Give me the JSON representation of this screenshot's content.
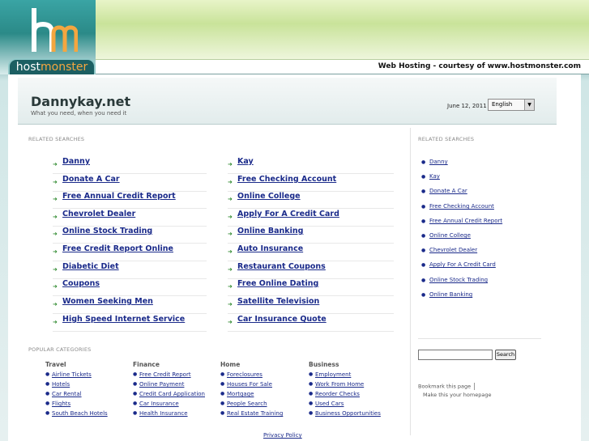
{
  "branding": {
    "logo_word_host": "host",
    "logo_word_monster": "monster",
    "hosting_line": "Web Hosting - courtesy of www.hostmonster.com"
  },
  "header": {
    "site_title": "Dannykay.net",
    "tagline": "What you need, when you need it",
    "date": "June 12, 2011",
    "language": "English"
  },
  "related_searches": {
    "label": "RELATED SEARCHES",
    "left": [
      "Danny",
      "Donate A Car",
      "Free Annual Credit Report",
      "Chevrolet Dealer",
      "Online Stock Trading",
      "Free Credit Report Online",
      "Diabetic Diet",
      "Coupons",
      "Women Seeking Men",
      "High Speed Internet Service"
    ],
    "right": [
      "Kay",
      "Free Checking Account",
      "Online College",
      "Apply For A Credit Card",
      "Online Banking",
      "Auto Insurance",
      "Restaurant Coupons",
      "Free Online Dating",
      "Satellite Television",
      "Car Insurance Quote"
    ]
  },
  "sidebar": {
    "label": "RELATED SEARCHES",
    "items": [
      "Danny",
      "Kay",
      "Donate A Car",
      "Free Checking Account",
      "Free Annual Credit Report",
      "Online College",
      "Chevrolet Dealer",
      "Apply For A Credit Card",
      "Online Stock Trading",
      "Online Banking"
    ],
    "search_button": "Search",
    "bookmark": "Bookmark this page",
    "homepage": "Make this your homepage"
  },
  "popular": {
    "label": "POPULAR CATEGORIES",
    "columns": [
      {
        "title": "Travel",
        "links": [
          "Airline Tickets",
          "Hotels",
          "Car Rental",
          "Flights",
          "South Beach Hotels"
        ]
      },
      {
        "title": "Finance",
        "links": [
          "Free Credit Report",
          "Online Payment",
          "Credit Card Application",
          "Car Insurance",
          "Health Insurance"
        ]
      },
      {
        "title": "Home",
        "links": [
          "Foreclosures",
          "Houses For Sale",
          "Mortgage",
          "People Search",
          "Real Estate Training"
        ]
      },
      {
        "title": "Business",
        "links": [
          "Employment",
          "Work From Home",
          "Reorder Checks",
          "Used Cars",
          "Business Opportunities"
        ]
      }
    ]
  },
  "footer": {
    "privacy": "Privacy Policy"
  },
  "colors": {
    "link": "#1a2a8a",
    "arrow": "#2f8a2f",
    "brand_teal": "#1c5f62",
    "brand_orange": "#f4a640"
  }
}
